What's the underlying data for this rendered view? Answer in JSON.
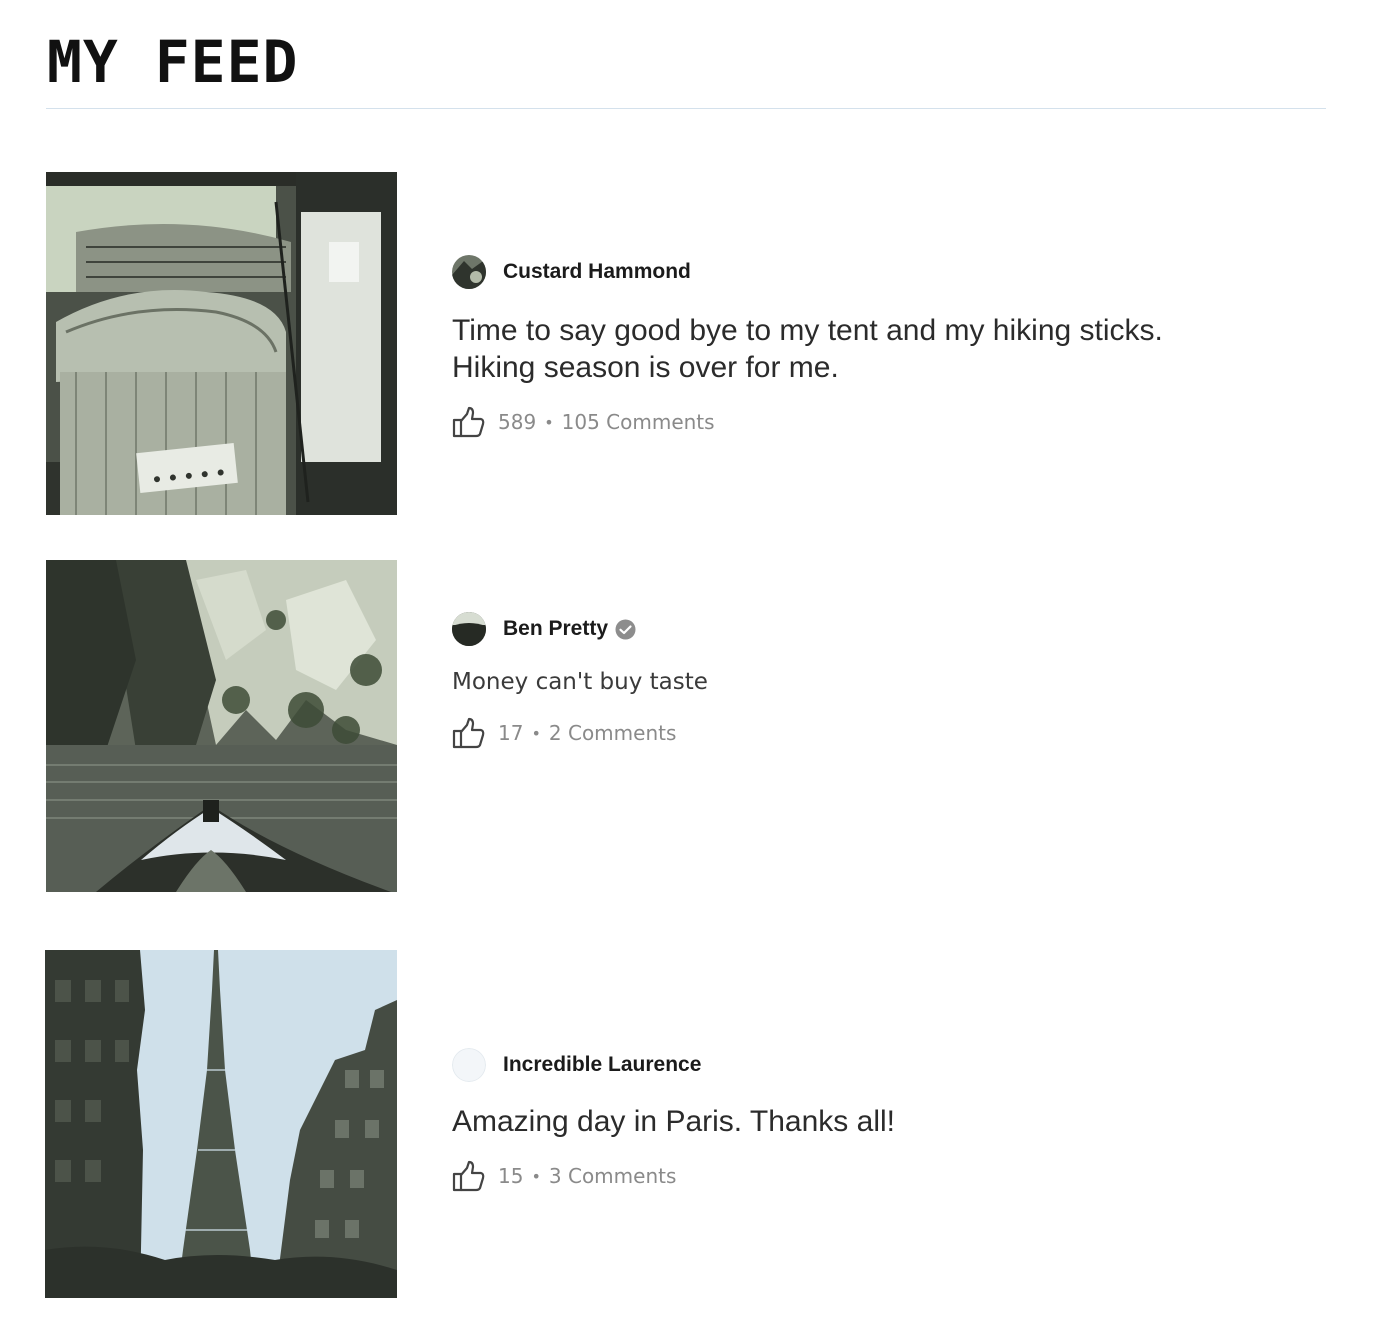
{
  "page": {
    "title": "MY FEED"
  },
  "posts": [
    {
      "author": "Custard Hammond",
      "verified": false,
      "text_line1": "Time to say good bye to my tent and my hiking sticks.",
      "text_line2": "Hiking season is over for me.",
      "likes": "589",
      "comments": "105 Comments",
      "image_icon": "laundry-basket-photo"
    },
    {
      "author": "Ben Pretty",
      "verified": true,
      "text_line1": "Money can't buy taste",
      "likes": "17",
      "comments": "2 Comments",
      "image_icon": "kayak-gorge-photo"
    },
    {
      "author": "Incredible Laurence",
      "verified": false,
      "text_line1": "Amazing day in Paris. Thanks all!",
      "likes": "15",
      "comments": "3 Comments",
      "image_icon": "eiffel-tower-photo"
    }
  ],
  "separator": "•",
  "colors": {
    "divider": "#d4e1ec",
    "meta_text": "#8a8a8a",
    "sky": "#cfe0ea"
  }
}
